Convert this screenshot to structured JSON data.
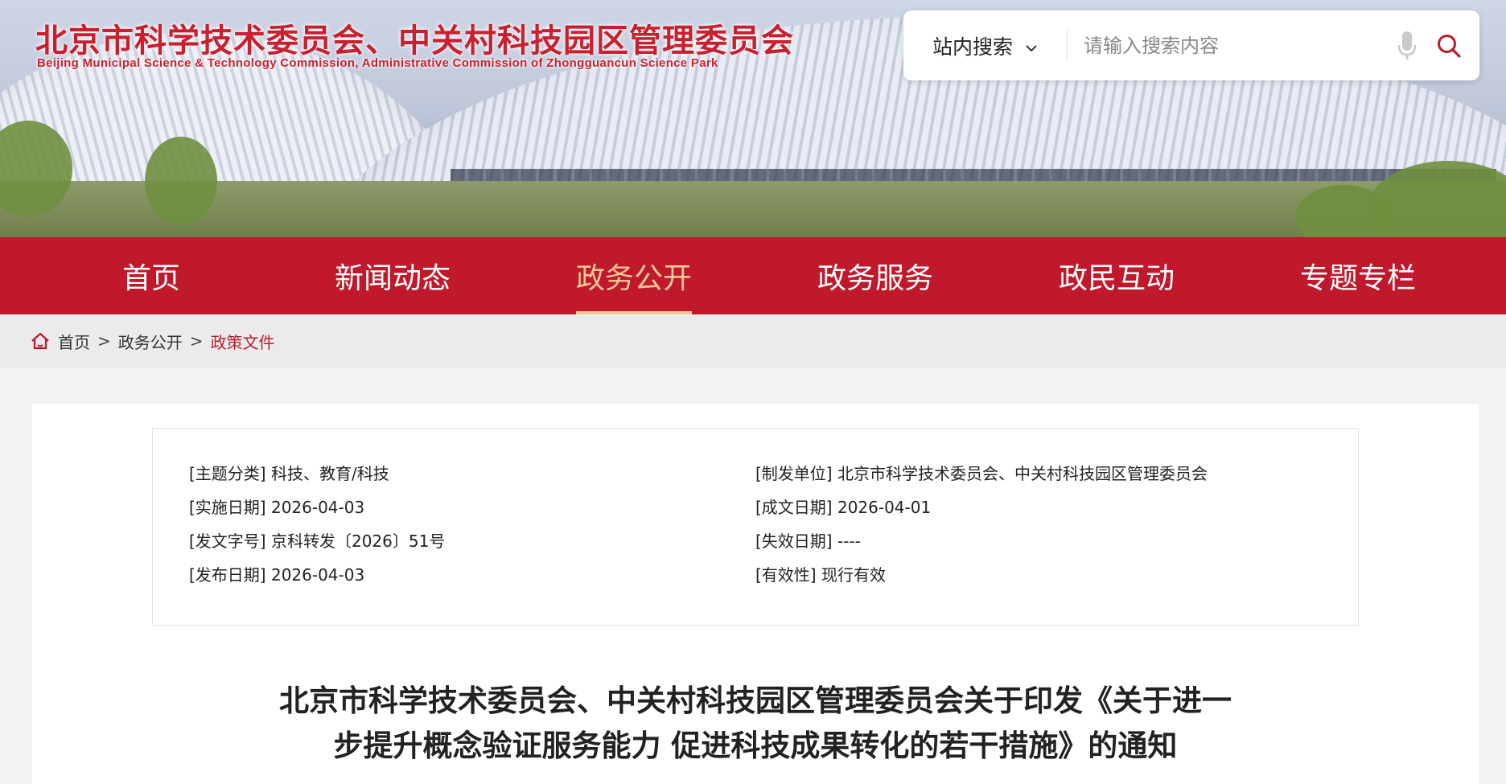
{
  "header": {
    "title": "北京市科学技术委员会、中关村科技园区管理委员会",
    "subtitle": "Beijing Municipal Science & Technology Commission, Administrative Commission of Zhongguancun Science Park"
  },
  "search": {
    "scope_label": "站内搜索",
    "placeholder": "请输入搜索内容",
    "icons": [
      "chevron-down-icon",
      "microphone-icon",
      "search-icon"
    ]
  },
  "nav": {
    "items": [
      {
        "label": "首页",
        "active": false
      },
      {
        "label": "新闻动态",
        "active": false
      },
      {
        "label": "政务公开",
        "active": true
      },
      {
        "label": "政务服务",
        "active": false
      },
      {
        "label": "政民互动",
        "active": false
      },
      {
        "label": "专题专栏",
        "active": false
      }
    ]
  },
  "breadcrumb": {
    "items": [
      "首页",
      "政务公开",
      "政策文件"
    ],
    "separator": ">"
  },
  "meta": {
    "left": [
      {
        "key": "[主题分类]",
        "value": "科技、教育/科技"
      },
      {
        "key": "[实施日期]",
        "value": "2026-04-03"
      },
      {
        "key": "[发文字号]",
        "value": "京科转发〔2026〕51号"
      },
      {
        "key": "[发布日期]",
        "value": "2026-04-03"
      }
    ],
    "right": [
      {
        "key": "[制发单位]",
        "value": "北京市科学技术委员会、中关村科技园区管理委员会"
      },
      {
        "key": "[成文日期]",
        "value": "2026-04-01"
      },
      {
        "key": "[失效日期]",
        "value": "----"
      },
      {
        "key": "[有效性]",
        "value": "现行有效"
      }
    ]
  },
  "document": {
    "title_line1": "北京市科学技术委员会、中关村科技园区管理委员会关于印发《关于进一",
    "title_line2": "步提升概念验证服务能力 促进科技成果转化的若干措施》的通知"
  },
  "colors": {
    "brand_red": "#c0192c",
    "nav_active": "#f2c898",
    "breadcrumb_current": "#b7202e"
  }
}
